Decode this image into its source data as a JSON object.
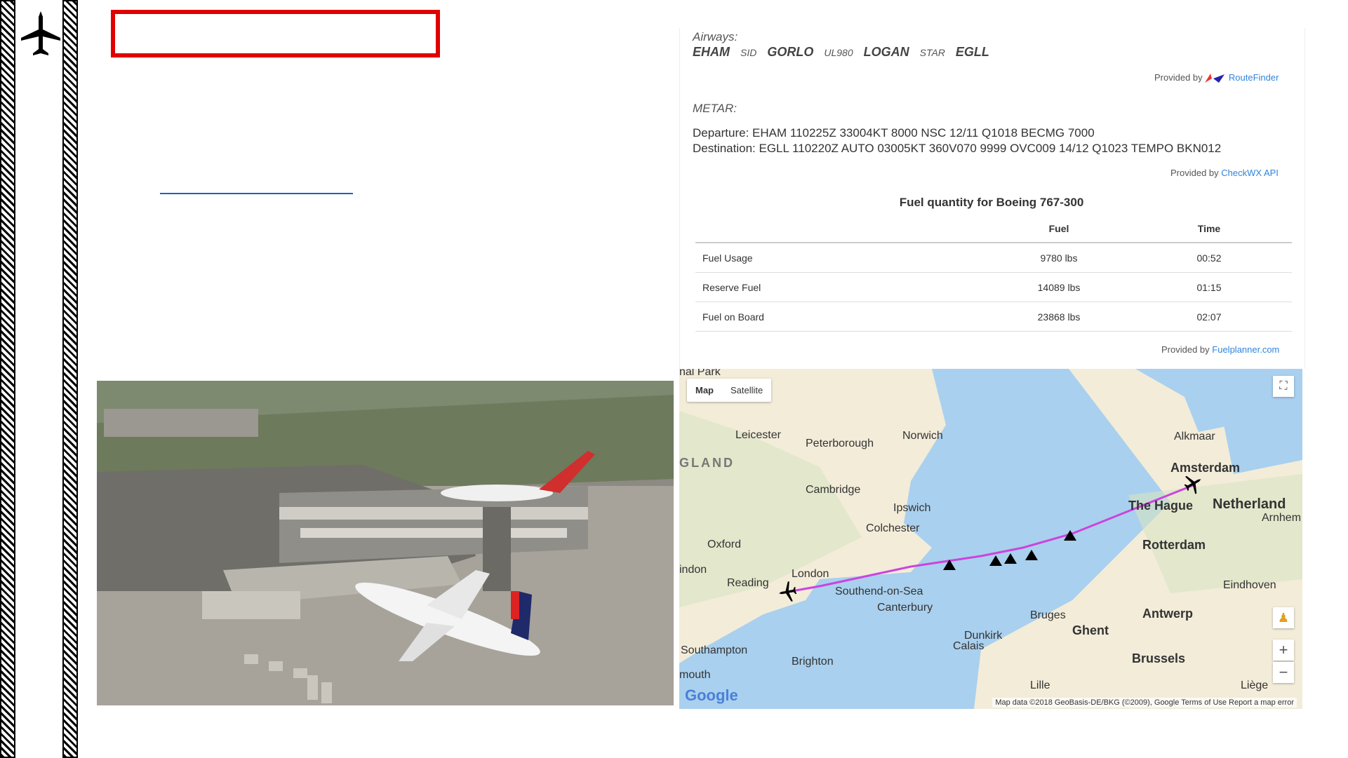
{
  "panel": {
    "airways_label": "Airways:",
    "route": [
      {
        "text": "EHAM",
        "type": "big"
      },
      {
        "text": "SID",
        "type": "small"
      },
      {
        "text": "GORLO",
        "type": "big"
      },
      {
        "text": "UL980",
        "type": "small"
      },
      {
        "text": "LOGAN",
        "type": "big"
      },
      {
        "text": "STAR",
        "type": "small"
      },
      {
        "text": "EGLL",
        "type": "big"
      }
    ],
    "provided_by": "Provided by",
    "routefinder_link": "RouteFinder",
    "metar_label": "METAR:",
    "departure": "Departure: EHAM 110225Z 33004KT 8000 NSC 12/11 Q1018 BECMG 7000",
    "destination": "Destination: EGLL 110220Z AUTO 03005KT 360V070 9999 OVC009 14/12 Q1023 TEMPO BKN012",
    "checkwx_link": "CheckWX API"
  },
  "fuel": {
    "title": "Fuel quantity for Boeing 767-300",
    "col_fuel": "Fuel",
    "col_time": "Time",
    "rows": [
      {
        "name": "Fuel Usage",
        "fuel": "9780 lbs",
        "time": "00:52"
      },
      {
        "name": "Reserve Fuel",
        "fuel": "14089 lbs",
        "time": "01:15"
      },
      {
        "name": "Fuel on Board",
        "fuel": "23868 lbs",
        "time": "02:07"
      }
    ],
    "provided_by": "Provided by",
    "fuelplanner_link": "Fuelplanner.com"
  },
  "map": {
    "tab_map": "Map",
    "tab_satellite": "Satellite",
    "labels": {
      "nal_park": "nal Park",
      "leicester": "Leicester",
      "peterborough": "Peterborough",
      "norwich": "Norwich",
      "gland": "GLAND",
      "cambridge": "Cambridge",
      "ipswich": "Ipswich",
      "colchester": "Colchester",
      "oxford": "Oxford",
      "indon": "indon",
      "reading": "Reading",
      "london": "London",
      "southend": "Southend-on-Sea",
      "canterbury": "Canterbury",
      "southampton": "Southampton",
      "brighton": "Brighton",
      "mouth": "mouth",
      "calais": "Calais",
      "dunkirk": "Dunkirk",
      "bruges": "Bruges",
      "ghent": "Ghent",
      "antwerp": "Antwerp",
      "brussels": "Brussels",
      "lille": "Lille",
      "liege": "Liège",
      "alkmaar": "Alkmaar",
      "amsterdam": "Amsterdam",
      "hague": "The Hague",
      "netherlands": "Netherland",
      "arnhem": "Arnhem",
      "rotterdam": "Rotterdam",
      "eindhoven": "Eindhoven"
    },
    "zoom_in": "+",
    "zoom_out": "−",
    "google": "Google",
    "attribution": "Map data ©2018 GeoBasis-DE/BKG (©2009), Google   Terms of Use   Report a map error"
  },
  "colors": {
    "accent_red": "#e10000",
    "link_blue": "#2e86de",
    "route_purple": "#cc44dd"
  }
}
